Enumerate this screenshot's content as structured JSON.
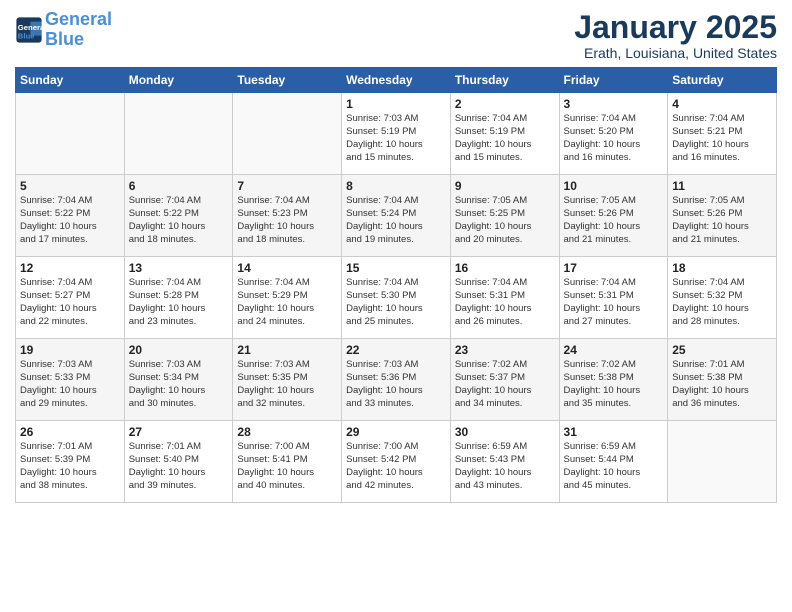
{
  "header": {
    "logo_line1": "General",
    "logo_line2": "Blue",
    "title": "January 2025",
    "subtitle": "Erath, Louisiana, United States"
  },
  "days_of_week": [
    "Sunday",
    "Monday",
    "Tuesday",
    "Wednesday",
    "Thursday",
    "Friday",
    "Saturday"
  ],
  "weeks": [
    [
      {
        "day": "",
        "text": ""
      },
      {
        "day": "",
        "text": ""
      },
      {
        "day": "",
        "text": ""
      },
      {
        "day": "1",
        "text": "Sunrise: 7:03 AM\nSunset: 5:19 PM\nDaylight: 10 hours\nand 15 minutes."
      },
      {
        "day": "2",
        "text": "Sunrise: 7:04 AM\nSunset: 5:19 PM\nDaylight: 10 hours\nand 15 minutes."
      },
      {
        "day": "3",
        "text": "Sunrise: 7:04 AM\nSunset: 5:20 PM\nDaylight: 10 hours\nand 16 minutes."
      },
      {
        "day": "4",
        "text": "Sunrise: 7:04 AM\nSunset: 5:21 PM\nDaylight: 10 hours\nand 16 minutes."
      }
    ],
    [
      {
        "day": "5",
        "text": "Sunrise: 7:04 AM\nSunset: 5:22 PM\nDaylight: 10 hours\nand 17 minutes."
      },
      {
        "day": "6",
        "text": "Sunrise: 7:04 AM\nSunset: 5:22 PM\nDaylight: 10 hours\nand 18 minutes."
      },
      {
        "day": "7",
        "text": "Sunrise: 7:04 AM\nSunset: 5:23 PM\nDaylight: 10 hours\nand 18 minutes."
      },
      {
        "day": "8",
        "text": "Sunrise: 7:04 AM\nSunset: 5:24 PM\nDaylight: 10 hours\nand 19 minutes."
      },
      {
        "day": "9",
        "text": "Sunrise: 7:05 AM\nSunset: 5:25 PM\nDaylight: 10 hours\nand 20 minutes."
      },
      {
        "day": "10",
        "text": "Sunrise: 7:05 AM\nSunset: 5:26 PM\nDaylight: 10 hours\nand 21 minutes."
      },
      {
        "day": "11",
        "text": "Sunrise: 7:05 AM\nSunset: 5:26 PM\nDaylight: 10 hours\nand 21 minutes."
      }
    ],
    [
      {
        "day": "12",
        "text": "Sunrise: 7:04 AM\nSunset: 5:27 PM\nDaylight: 10 hours\nand 22 minutes."
      },
      {
        "day": "13",
        "text": "Sunrise: 7:04 AM\nSunset: 5:28 PM\nDaylight: 10 hours\nand 23 minutes."
      },
      {
        "day": "14",
        "text": "Sunrise: 7:04 AM\nSunset: 5:29 PM\nDaylight: 10 hours\nand 24 minutes."
      },
      {
        "day": "15",
        "text": "Sunrise: 7:04 AM\nSunset: 5:30 PM\nDaylight: 10 hours\nand 25 minutes."
      },
      {
        "day": "16",
        "text": "Sunrise: 7:04 AM\nSunset: 5:31 PM\nDaylight: 10 hours\nand 26 minutes."
      },
      {
        "day": "17",
        "text": "Sunrise: 7:04 AM\nSunset: 5:31 PM\nDaylight: 10 hours\nand 27 minutes."
      },
      {
        "day": "18",
        "text": "Sunrise: 7:04 AM\nSunset: 5:32 PM\nDaylight: 10 hours\nand 28 minutes."
      }
    ],
    [
      {
        "day": "19",
        "text": "Sunrise: 7:03 AM\nSunset: 5:33 PM\nDaylight: 10 hours\nand 29 minutes."
      },
      {
        "day": "20",
        "text": "Sunrise: 7:03 AM\nSunset: 5:34 PM\nDaylight: 10 hours\nand 30 minutes."
      },
      {
        "day": "21",
        "text": "Sunrise: 7:03 AM\nSunset: 5:35 PM\nDaylight: 10 hours\nand 32 minutes."
      },
      {
        "day": "22",
        "text": "Sunrise: 7:03 AM\nSunset: 5:36 PM\nDaylight: 10 hours\nand 33 minutes."
      },
      {
        "day": "23",
        "text": "Sunrise: 7:02 AM\nSunset: 5:37 PM\nDaylight: 10 hours\nand 34 minutes."
      },
      {
        "day": "24",
        "text": "Sunrise: 7:02 AM\nSunset: 5:38 PM\nDaylight: 10 hours\nand 35 minutes."
      },
      {
        "day": "25",
        "text": "Sunrise: 7:01 AM\nSunset: 5:38 PM\nDaylight: 10 hours\nand 36 minutes."
      }
    ],
    [
      {
        "day": "26",
        "text": "Sunrise: 7:01 AM\nSunset: 5:39 PM\nDaylight: 10 hours\nand 38 minutes."
      },
      {
        "day": "27",
        "text": "Sunrise: 7:01 AM\nSunset: 5:40 PM\nDaylight: 10 hours\nand 39 minutes."
      },
      {
        "day": "28",
        "text": "Sunrise: 7:00 AM\nSunset: 5:41 PM\nDaylight: 10 hours\nand 40 minutes."
      },
      {
        "day": "29",
        "text": "Sunrise: 7:00 AM\nSunset: 5:42 PM\nDaylight: 10 hours\nand 42 minutes."
      },
      {
        "day": "30",
        "text": "Sunrise: 6:59 AM\nSunset: 5:43 PM\nDaylight: 10 hours\nand 43 minutes."
      },
      {
        "day": "31",
        "text": "Sunrise: 6:59 AM\nSunset: 5:44 PM\nDaylight: 10 hours\nand 45 minutes."
      },
      {
        "day": "",
        "text": ""
      }
    ]
  ]
}
